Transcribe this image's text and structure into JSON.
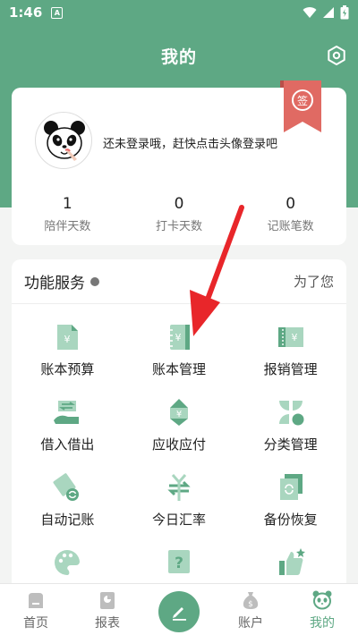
{
  "status_bar": {
    "time": "1:46",
    "notification_glyph": "A"
  },
  "header": {
    "title": "我的",
    "settings_icon": "gear-icon"
  },
  "profile": {
    "login_prompt": "还未登录哦，赶快点击头像登录吧",
    "checkin_badge": "签",
    "stats": [
      {
        "value": "1",
        "label": "陪伴天数"
      },
      {
        "value": "0",
        "label": "打卡天数"
      },
      {
        "value": "0",
        "label": "记账笔数"
      }
    ]
  },
  "services": {
    "title": "功能服务",
    "more": "为了您",
    "items": [
      {
        "label": "账本预算",
        "icon": "budget-icon"
      },
      {
        "label": "账本管理",
        "icon": "ledger-icon"
      },
      {
        "label": "报销管理",
        "icon": "reimburse-icon"
      },
      {
        "label": "借入借出",
        "icon": "lend-borrow-icon"
      },
      {
        "label": "应收应付",
        "icon": "receivable-icon"
      },
      {
        "label": "分类管理",
        "icon": "category-icon"
      },
      {
        "label": "自动记账",
        "icon": "auto-record-icon"
      },
      {
        "label": "今日汇率",
        "icon": "exchange-rate-icon"
      },
      {
        "label": "备份恢复",
        "icon": "backup-icon"
      }
    ]
  },
  "nav": {
    "items": [
      {
        "label": "首页"
      },
      {
        "label": "报表"
      },
      {
        "label": ""
      },
      {
        "label": "账户"
      },
      {
        "label": "我的"
      }
    ]
  },
  "colors": {
    "accent": "#5ea884",
    "annotation_arrow": "#e8262a"
  }
}
